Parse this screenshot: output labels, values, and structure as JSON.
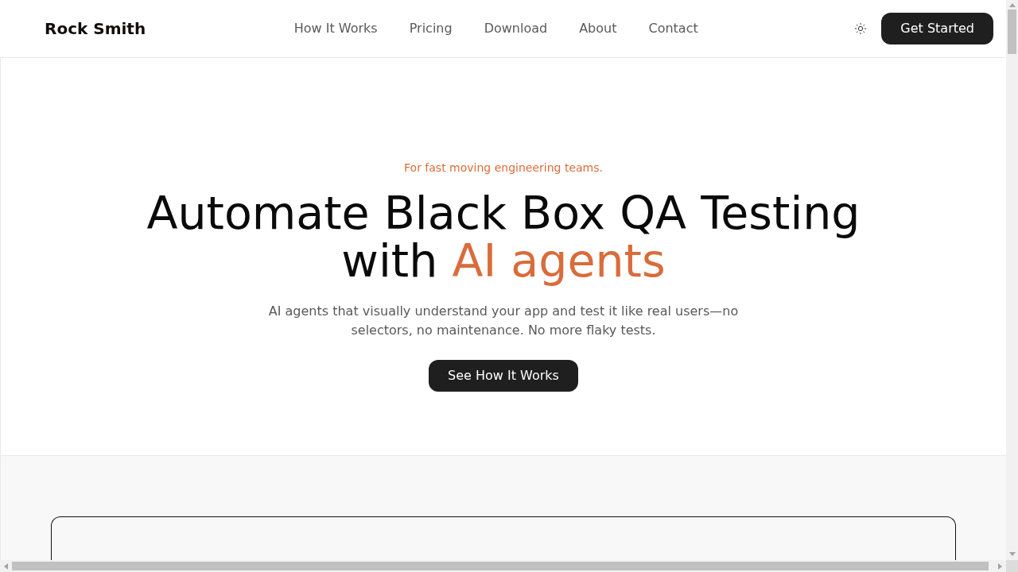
{
  "header": {
    "logo": "Rock Smith",
    "nav": [
      "How It Works",
      "Pricing",
      "Download",
      "About",
      "Contact"
    ],
    "cta": "Get Started"
  },
  "hero": {
    "tagline": "For fast moving engineering teams.",
    "headline": "Automate Black Box QA Testing with",
    "headline_highlight": "AI agents",
    "subtitle": "AI agents that visually understand your app and test it like real users—no selectors, no maintenance. No more flaky tests.",
    "button": "See How It Works"
  }
}
